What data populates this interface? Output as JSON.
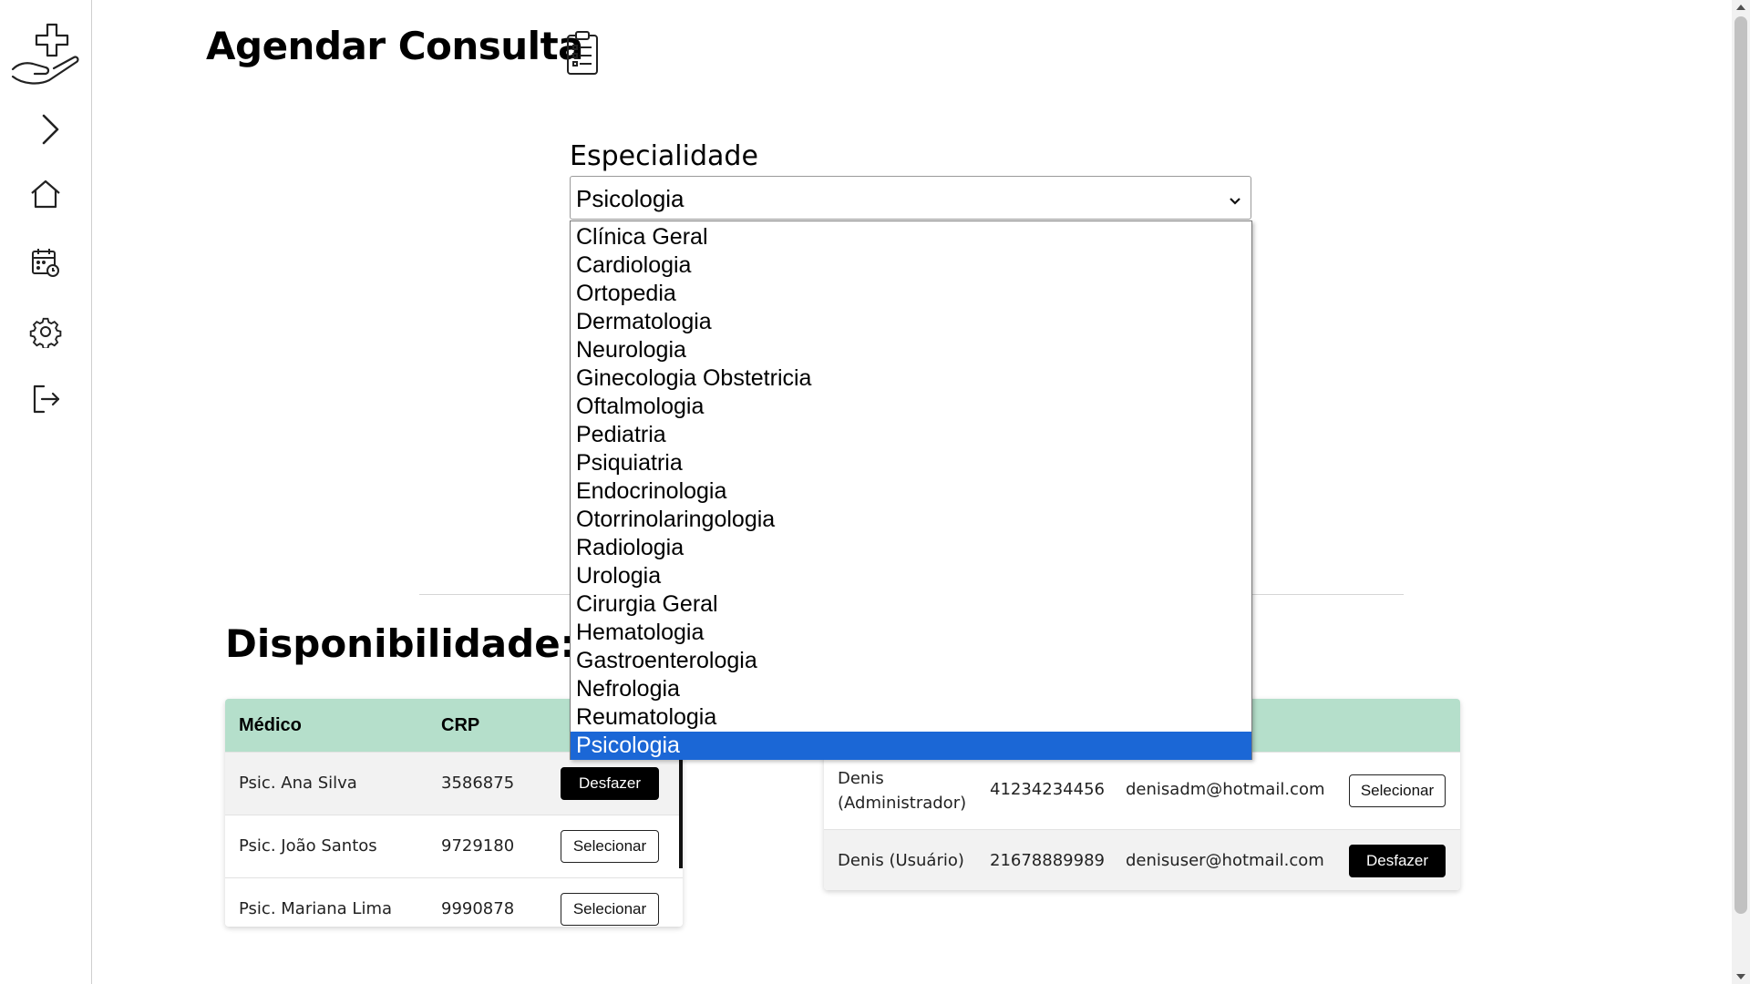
{
  "page": {
    "title": "Agendar Consulta",
    "section_title": "Disponibilidade:"
  },
  "sidebar": {
    "icons": [
      "medical-hand-logo-icon",
      "chevron-right-icon",
      "home-icon",
      "calendar-clock-icon",
      "gear-icon",
      "logout-icon"
    ]
  },
  "especialidade": {
    "label": "Especialidade",
    "selected": "Psicologia",
    "options": [
      "Clínica Geral",
      "Cardiologia",
      "Ortopedia",
      "Dermatologia",
      "Neurologia",
      "Ginecologia Obstetricia",
      "Oftalmologia",
      "Pediatria",
      "Psiquiatria",
      "Endocrinologia",
      "Otorrinolaringologia",
      "Radiologia",
      "Urologia",
      "Cirurgia Geral",
      "Hematologia",
      "Gastroenterologia",
      "Nefrologia",
      "Reumatologia",
      "Psicologia"
    ]
  },
  "medicos_table": {
    "headers": {
      "medico": "Médico",
      "crp": "CRP"
    },
    "rows": [
      {
        "name": "Psic. Ana Silva",
        "crp": "3586875",
        "action": "Desfazer"
      },
      {
        "name": "Psic. João Santos",
        "crp": "9729180",
        "action": "Selecionar"
      },
      {
        "name": "Psic. Mariana Lima",
        "crp": "9990878",
        "action": "Selecionar"
      }
    ]
  },
  "pacientes_table": {
    "rows": [
      {
        "name": "Denis (Administrador)",
        "doc": "41234234456",
        "email": "denisadm@hotmail.com",
        "action": "Selecionar"
      },
      {
        "name": "Denis (Usuário)",
        "doc": "21678889989",
        "email": "denisuser@hotmail.com",
        "action": "Desfazer"
      }
    ]
  },
  "colors": {
    "table_header": "#b5dfcb",
    "dropdown_selected": "#1b67d6",
    "button_solid": "#000000"
  }
}
